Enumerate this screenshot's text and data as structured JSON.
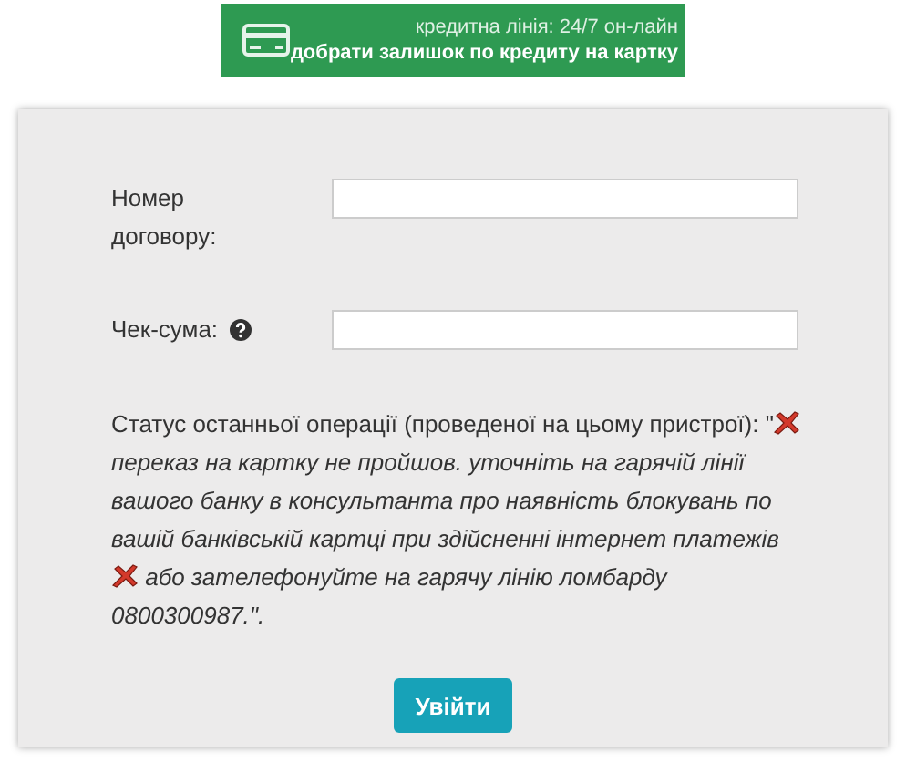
{
  "banner": {
    "line_1": "кредитна лінія: 24/7 он-лайн",
    "line_2": "добрати залишок по кредиту на картку"
  },
  "fields": [
    {
      "label": "Номер договору:",
      "help": false
    },
    {
      "label": "Чек-сума:",
      "help": true
    }
  ],
  "status": {
    "label": "Статус останньої операції (проведеної на цьому пристрої): \"",
    "parts": [
      {
        "kind": "icon"
      },
      {
        "kind": "text",
        "text": "переказ на картку не пройшов. уточніть на гарячій лінії вашого банку в консультанта про наявність блокувань по вашій банківській картці при здійсненні інтернет платежів"
      },
      {
        "kind": "icon"
      },
      {
        "kind": "text",
        "text": "або зателефонуйте на гарячу лінію ломбарду"
      },
      {
        "kind": "text",
        "text": "0800300987.\"."
      }
    ]
  },
  "button": "Увійти"
}
